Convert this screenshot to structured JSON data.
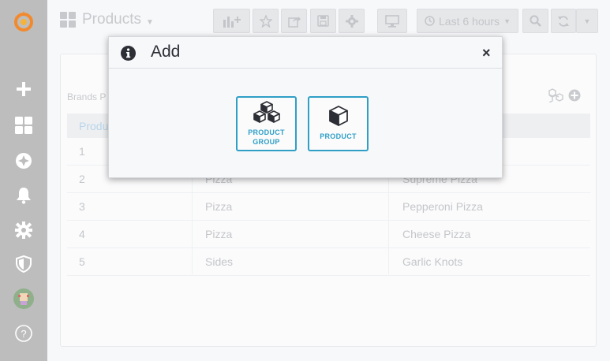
{
  "topbar": {
    "dashboard_title": "Products",
    "time_range": "Last 6 hours"
  },
  "panel": {
    "brands_label": "Brands P",
    "table": {
      "headers": [
        "Produ",
        "",
        ""
      ],
      "rows": [
        [
          "1",
          "",
          ""
        ],
        [
          "2",
          "Pizza",
          "Supreme Pizza"
        ],
        [
          "3",
          "Pizza",
          "Pepperoni Pizza"
        ],
        [
          "4",
          "Pizza",
          "Cheese Pizza"
        ],
        [
          "5",
          "Sides",
          "Garlic Knots"
        ]
      ]
    }
  },
  "modal": {
    "title": "Add",
    "close": "×",
    "options": [
      {
        "line1": "PRODUCT",
        "line2": "GROUP"
      },
      {
        "line1": "PRODUCT",
        "line2": ""
      }
    ]
  },
  "sidebar": {
    "help": "?"
  },
  "colors": {
    "accent": "#2f9fc6",
    "sidebar_bg": "#bdbdbe",
    "modal_text": "#2d2f36"
  }
}
